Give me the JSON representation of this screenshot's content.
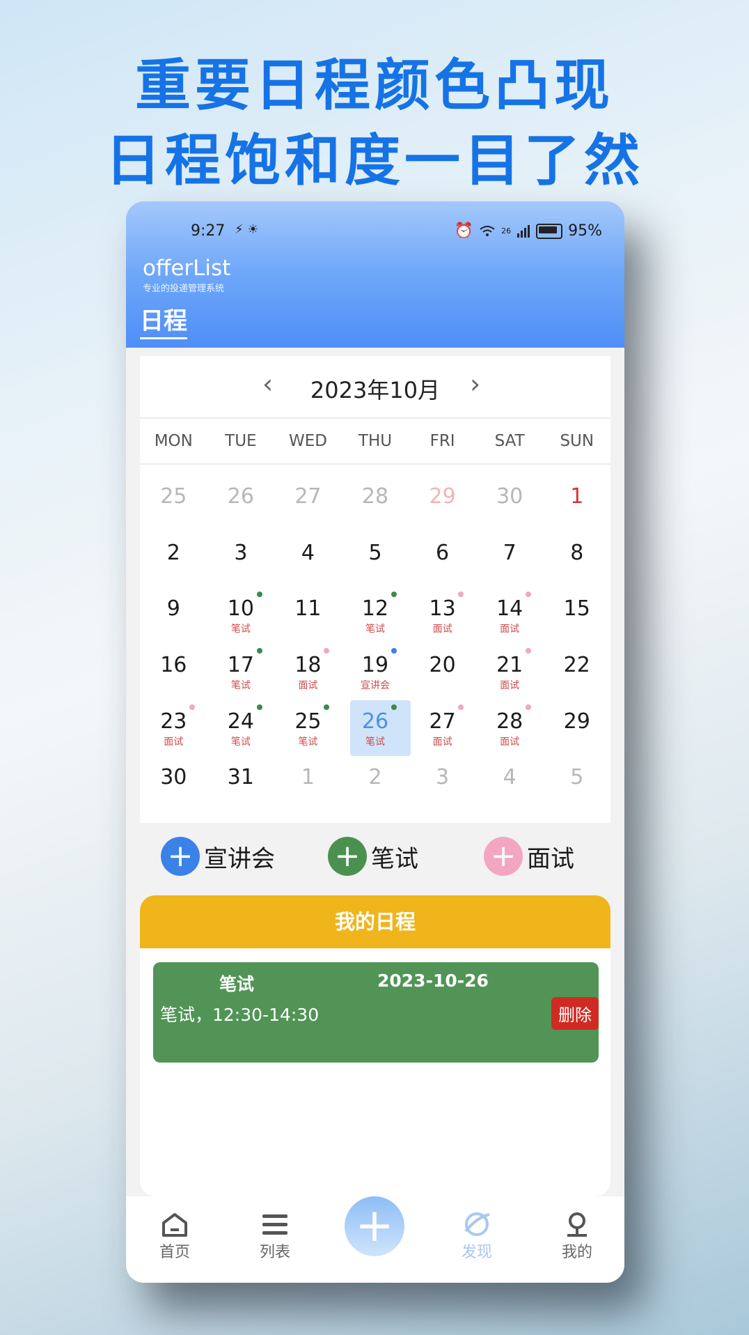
{
  "headline": {
    "line1": "重要日程颜色凸现",
    "line2": "日程饱和度一目了然"
  },
  "status": {
    "time": "9:27",
    "left_icons": "⚡ ☀",
    "network": "26",
    "battery": "95%"
  },
  "app": {
    "title": "offerList",
    "subtitle": "专业的投递管理系统",
    "page_tab": "日程"
  },
  "calendar": {
    "prev_icon": "‹",
    "next_icon": "›",
    "month_label": "2023年10月",
    "weekdays": [
      "MON",
      "TUE",
      "WED",
      "THU",
      "FRI",
      "SAT",
      "SUN"
    ],
    "weeks": [
      [
        {
          "d": "25",
          "style": "dim"
        },
        {
          "d": "26",
          "style": "dim"
        },
        {
          "d": "27",
          "style": "dim"
        },
        {
          "d": "28",
          "style": "dim"
        },
        {
          "d": "29",
          "style": "dimred"
        },
        {
          "d": "30",
          "style": "dim"
        },
        {
          "d": "1",
          "style": "red"
        }
      ],
      [
        {
          "d": "2"
        },
        {
          "d": "3"
        },
        {
          "d": "4"
        },
        {
          "d": "5"
        },
        {
          "d": "6"
        },
        {
          "d": "7"
        },
        {
          "d": "8"
        }
      ],
      [
        {
          "d": "9"
        },
        {
          "d": "10",
          "label": "笔试",
          "dot": "green"
        },
        {
          "d": "11"
        },
        {
          "d": "12",
          "label": "笔试",
          "dot": "green"
        },
        {
          "d": "13",
          "label": "面试",
          "dot": "pink"
        },
        {
          "d": "14",
          "label": "面试",
          "dot": "pink"
        },
        {
          "d": "15"
        }
      ],
      [
        {
          "d": "16"
        },
        {
          "d": "17",
          "label": "笔试",
          "dot": "green"
        },
        {
          "d": "18",
          "label": "面试",
          "dot": "pink"
        },
        {
          "d": "19",
          "label": "宣讲会",
          "dot": "blue"
        },
        {
          "d": "20"
        },
        {
          "d": "21",
          "label": "面试",
          "dot": "pink"
        },
        {
          "d": "22"
        }
      ],
      [
        {
          "d": "23",
          "label": "面试",
          "dot": "pink"
        },
        {
          "d": "24",
          "label": "笔试",
          "dot": "green"
        },
        {
          "d": "25",
          "label": "笔试",
          "dot": "green"
        },
        {
          "d": "26",
          "label": "笔试",
          "dot": "green",
          "selected": true
        },
        {
          "d": "27",
          "label": "面试",
          "dot": "pink"
        },
        {
          "d": "28",
          "label": "面试",
          "dot": "pink"
        },
        {
          "d": "29"
        }
      ],
      [
        {
          "d": "30"
        },
        {
          "d": "31"
        },
        {
          "d": "1",
          "style": "dim"
        },
        {
          "d": "2",
          "style": "dim"
        },
        {
          "d": "3",
          "style": "dim"
        },
        {
          "d": "4",
          "style": "dim"
        },
        {
          "d": "5",
          "style": "dim"
        }
      ]
    ]
  },
  "quick_add": [
    {
      "label": "宣讲会",
      "color": "#3b82e8",
      "icon": "plus-icon"
    },
    {
      "label": "笔试",
      "color": "#4a9150",
      "icon": "plus-icon"
    },
    {
      "label": "面试",
      "color": "#f3a6c2",
      "icon": "plus-icon"
    }
  ],
  "schedule": {
    "title": "我的日程",
    "events": [
      {
        "type": "笔试",
        "date": "2023-10-26",
        "desc": "笔试，12:30-14:30",
        "delete_label": "删除"
      }
    ]
  },
  "tabbar": {
    "items": [
      {
        "label": "首页",
        "icon": "home-icon"
      },
      {
        "label": "列表",
        "icon": "list-icon"
      },
      {
        "label": "发现",
        "icon": "discover-icon",
        "active": true
      },
      {
        "label": "我的",
        "icon": "profile-icon"
      }
    ],
    "fab_icon": "+"
  },
  "colors": {
    "accent": "#1673e6",
    "header": "#4e8ef7",
    "schedule_head": "#f0b51b",
    "event_green": "#519456",
    "delete_red": "#cf2b22"
  }
}
